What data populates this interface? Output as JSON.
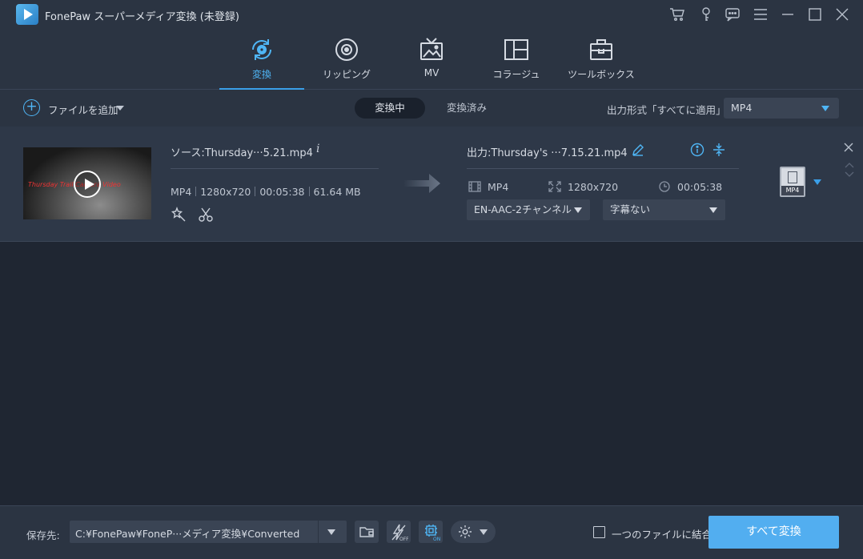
{
  "app": {
    "title": "FonePaw スーパーメディア変換 (未登録)"
  },
  "titlebar_icons": [
    "cart-icon",
    "key-icon",
    "feedback-icon",
    "menu-icon",
    "minimize-icon",
    "maximize-icon",
    "close-icon"
  ],
  "nav": {
    "tabs": [
      {
        "label": "変換",
        "icon": "convert-icon",
        "active": true
      },
      {
        "label": "リッピング",
        "icon": "disc-icon",
        "active": false
      },
      {
        "label": "MV",
        "icon": "tv-icon",
        "active": false
      },
      {
        "label": "コラージュ",
        "icon": "collage-icon",
        "active": false
      },
      {
        "label": "ツールボックス",
        "icon": "toolbox-icon",
        "active": false
      }
    ]
  },
  "toolbar": {
    "add_file": "ファイルを追加",
    "tab_converting": "変換中",
    "tab_converted": "変換済み",
    "output_format_label": "出力形式「すべてに適用」:",
    "output_format_value": "MP4"
  },
  "file": {
    "thumbnail_caption": "Thursday Trail Camera Video",
    "source_name": "ソース:Thursday···5.21.mp4",
    "source_format": "MP4",
    "source_resolution": "1280x720",
    "source_duration": "00:05:38",
    "source_size": "61.64 MB",
    "output_name": "出力:Thursday's ···7.15.21.mp4",
    "output_format": "MP4",
    "output_resolution": "1280x720",
    "output_duration": "00:05:38",
    "audio_track": "EN-AAC-2チャンネル",
    "subtitle": "字幕ない",
    "format_badge": "MP4"
  },
  "bottom": {
    "save_label": "保存先:",
    "save_path": "C:¥FonePaw¥FoneP···メディア変換¥Converted",
    "merge_label": "一つのファイルに結合",
    "merge_checked": false,
    "convert_all": "すべて変換"
  },
  "colors": {
    "accent": "#3a9fe8",
    "button": "#52aef0",
    "background": "#1f2632",
    "panel": "#2b3442"
  }
}
